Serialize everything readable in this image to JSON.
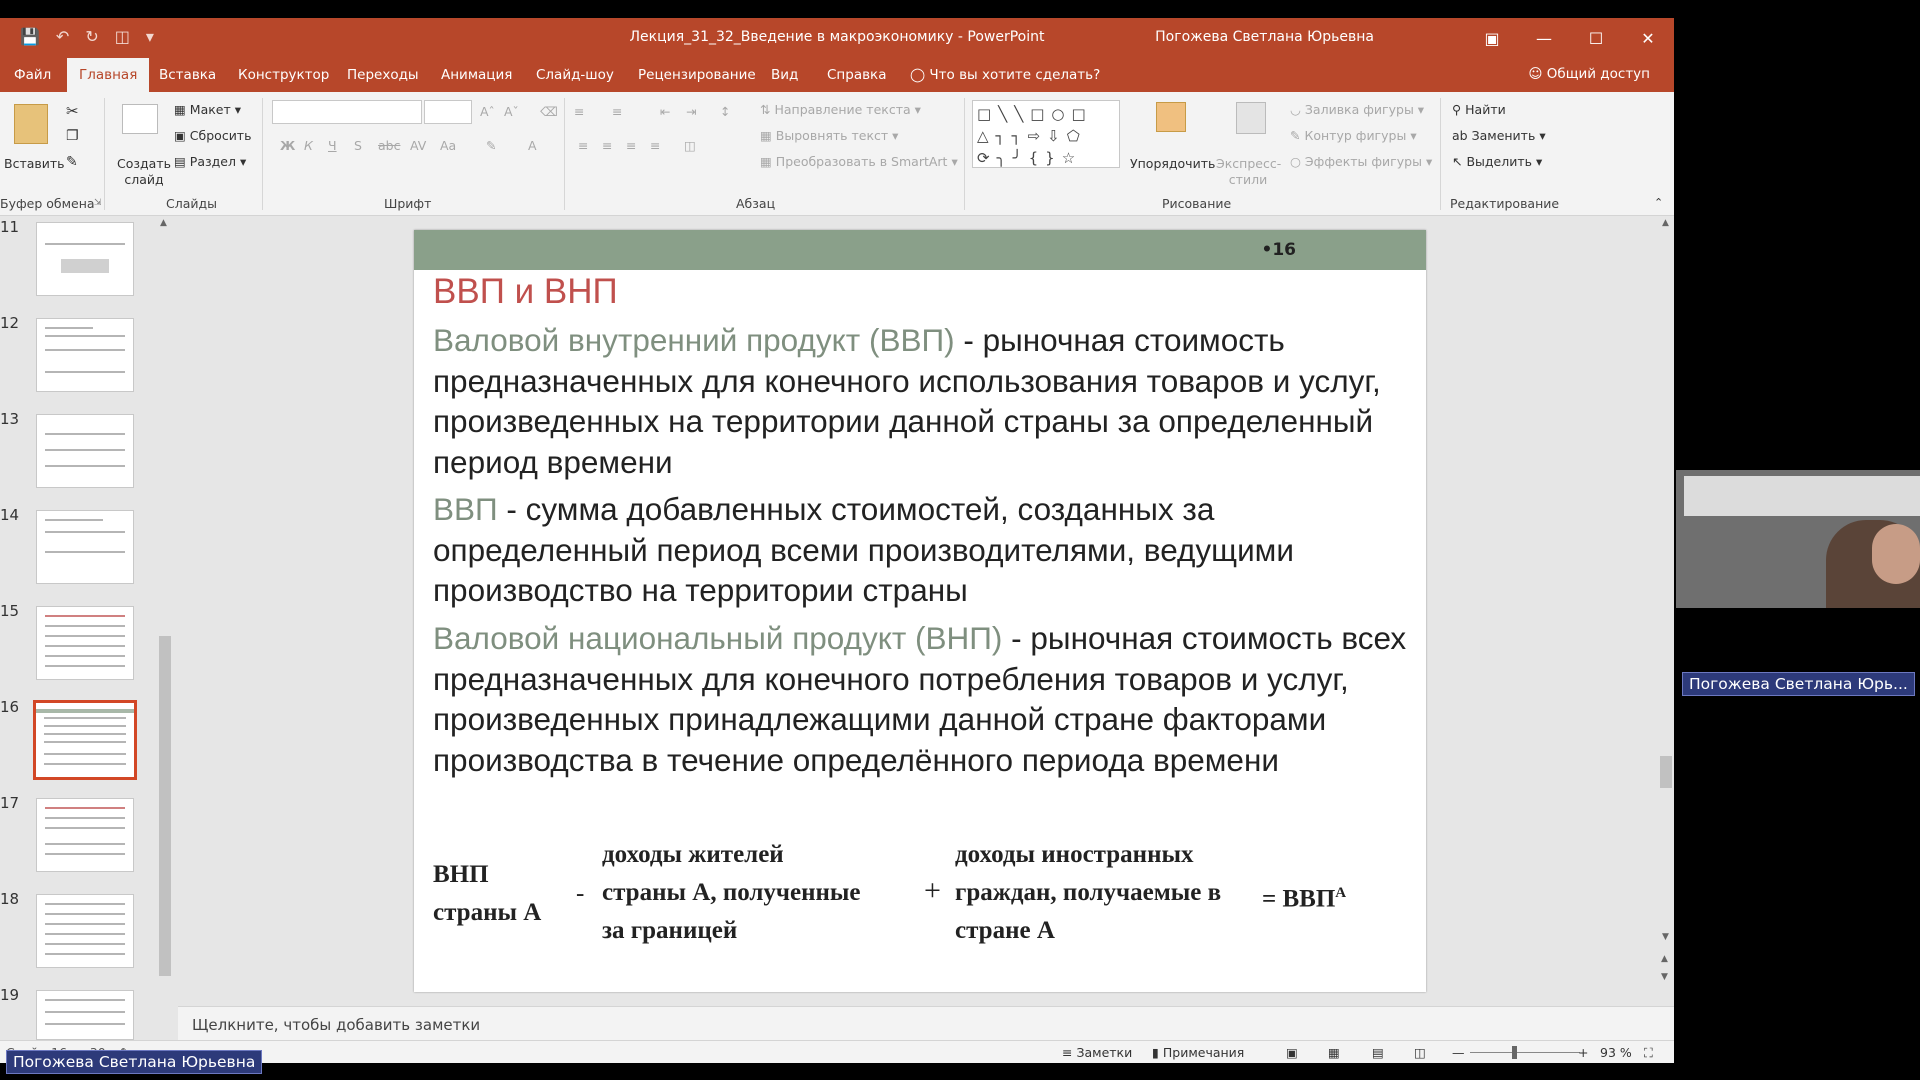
{
  "window": {
    "title": "Лекция_31_32_Введение в макроэкономику  -  PowerPoint",
    "user": "Погожева Светлана Юрьевна"
  },
  "tabs": [
    "Файл",
    "Главная",
    "Вставка",
    "Конструктор",
    "Переходы",
    "Анимация",
    "Слайд-шоу",
    "Рецензирование",
    "Вид",
    "Справка"
  ],
  "tell_me": "Что вы хотите сделать?",
  "share": "Общий доступ",
  "ribbon": {
    "paste": "Вставить",
    "new_slide": "Создать слайд",
    "layout": "Макет",
    "reset": "Сбросить",
    "section": "Раздел",
    "text_direction": "Направление текста",
    "align_text": "Выровнять текст",
    "smartart": "Преобразовать в SmartArt",
    "arrange": "Упорядочить",
    "quick_styles": "Экспресс-стили",
    "shape_fill": "Заливка фигуры",
    "shape_outline": "Контур фигуры",
    "shape_effects": "Эффекты фигуры",
    "find": "Найти",
    "replace": "Заменить",
    "select": "Выделить",
    "groups": {
      "clipboard": "Буфер обмена",
      "slides": "Слайды",
      "font": "Шрифт",
      "paragraph": "Абзац",
      "drawing": "Рисование",
      "editing": "Редактирование"
    }
  },
  "thumbnails": [
    "11",
    "12",
    "13",
    "14",
    "15",
    "16",
    "17",
    "18",
    "19"
  ],
  "selected_thumbnail": "16",
  "slide": {
    "number": "•16",
    "title": "ВВП и ВНП",
    "p1_term": "Валовой внутренний продукт (ВВП)",
    "p1_rest": " - рыночная стоимость предназначенных для конечного использования товаров и услуг, произведенных на территории данной страны за определенный период времени",
    "p2_term": "ВВП",
    "p2_rest": " - сумма добавленных стоимостей, созданных за определенный период всеми производителями, ведущими производство на территории страны",
    "p3_term": "Валовой национальный продукт (ВНП)",
    "p3_rest": " - рыночная стоимость всех предназначенных для конечного потребления товаров и услуг, произведенных принадлежащими данной стране факторами производства в течение определённого периода времени",
    "formula": {
      "lhs_1": "ВНП",
      "lhs_2": "страны А",
      "minus": "-",
      "a_1": "доходы жителей",
      "a_2": "страны А, полученные",
      "a_3": "за границей",
      "plus": "+",
      "b_1": "доходы иностранных",
      "b_2": "граждан, получаемые в",
      "b_3": "стране А",
      "eq": "= ВВП",
      "sup": "А"
    }
  },
  "notes_placeholder": "Щелкните, чтобы добавить заметки",
  "status": {
    "slide_counter": "Слайд 16 из 30",
    "notes": "Заметки",
    "comments": "Примечания",
    "zoom": "93 %"
  },
  "video": {
    "participant": "Погожева Светлана Юрь..."
  },
  "bottom_badge": "Погожева Светлана Юрьевна",
  "colors": {
    "accent": "#b7472a",
    "slide_title": "#c0504d",
    "slide_term": "#7f8f7f",
    "slide_bar": "#8aa08a"
  }
}
